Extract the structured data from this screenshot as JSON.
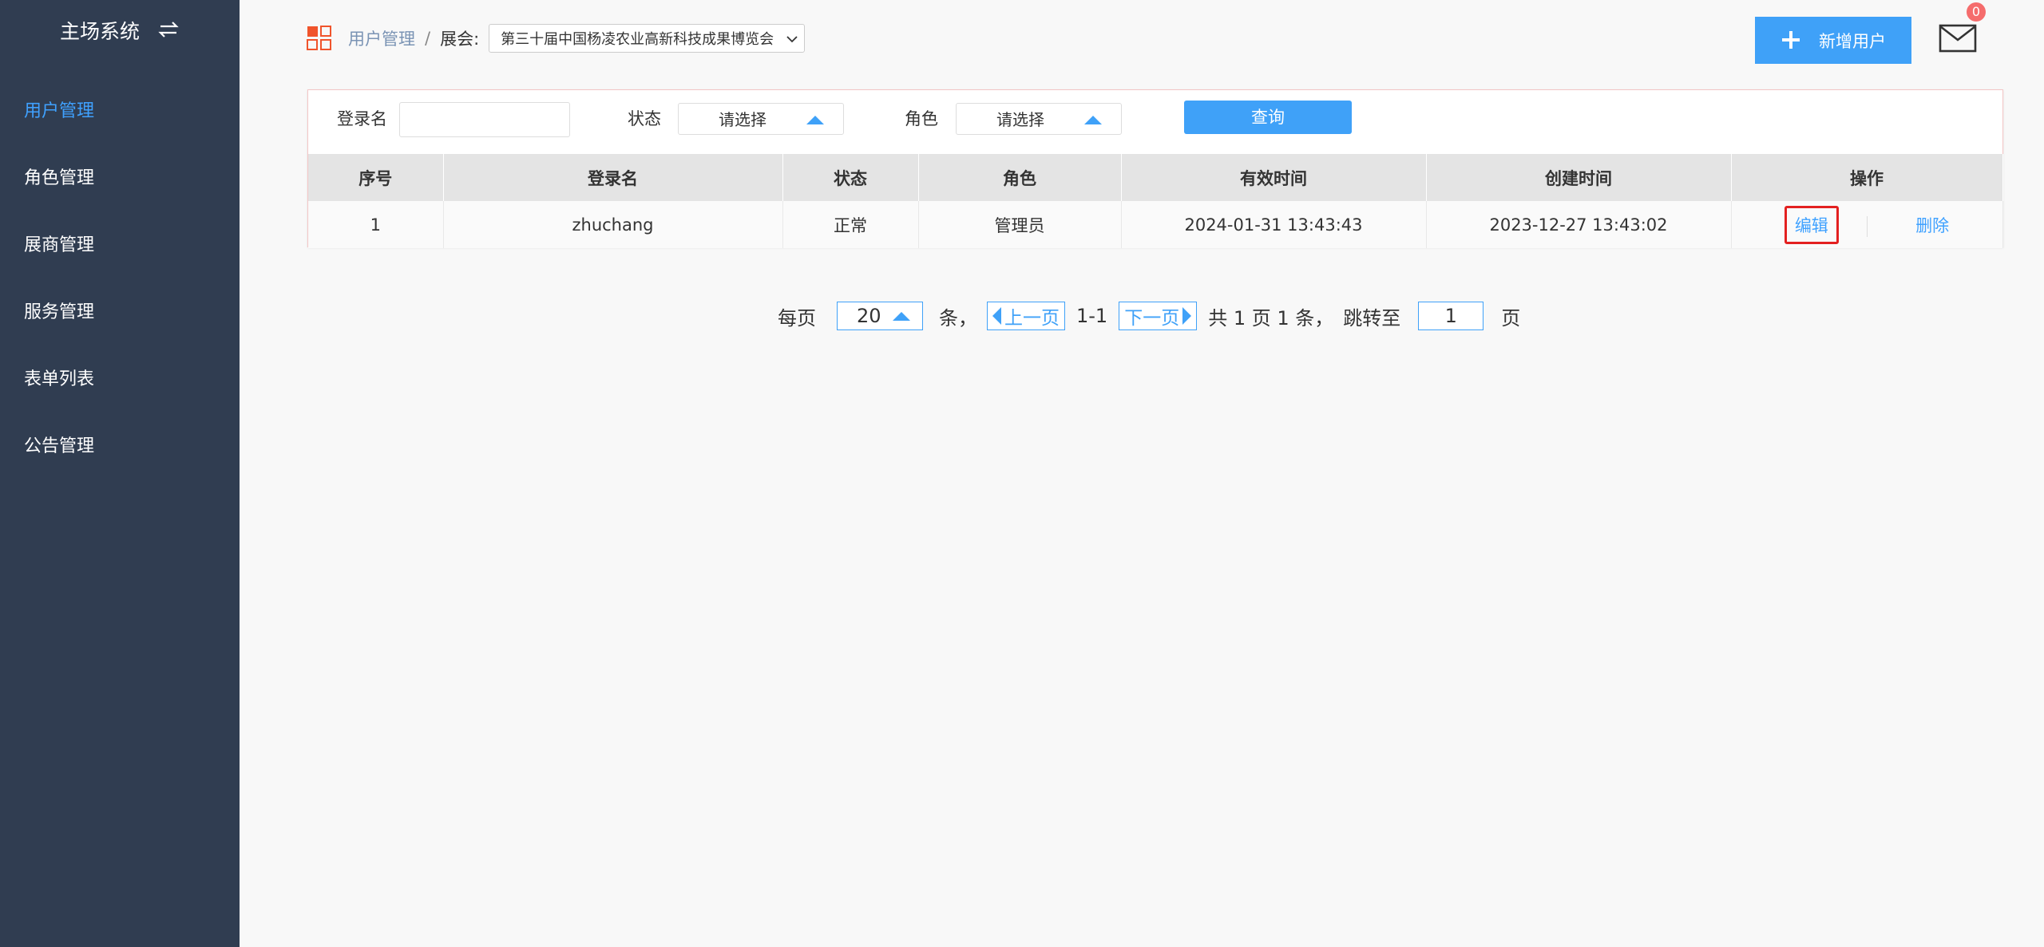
{
  "sidebar": {
    "brand": "主场系统",
    "items": [
      {
        "label": "用户管理"
      },
      {
        "label": "角色管理"
      },
      {
        "label": "展商管理"
      },
      {
        "label": "服务管理"
      },
      {
        "label": "表单列表"
      },
      {
        "label": "公告管理"
      }
    ],
    "active_index": 0
  },
  "header": {
    "breadcrumb": "用户管理",
    "separator": "/",
    "expo_label": "展会:",
    "expo_selected": "第三十届中国杨凌农业高新科技成果博览会",
    "add_user_label": "新增用户",
    "mail_badge": "0"
  },
  "filters": {
    "login_label": "登录名",
    "login_value": "",
    "status_label": "状态",
    "status_value": "请选择",
    "role_label": "角色",
    "role_value": "请选择",
    "query_label": "查询"
  },
  "table": {
    "columns": [
      "序号",
      "登录名",
      "状态",
      "角色",
      "有效时间",
      "创建时间",
      "操作"
    ],
    "rows": [
      {
        "index": "1",
        "login": "zhuchang",
        "status": "正常",
        "role": "管理员",
        "valid_time": "2024-01-31 13:43:43",
        "created_time": "2023-12-27 13:43:02",
        "edit": "编辑",
        "delete": "删除"
      }
    ]
  },
  "pager": {
    "per_page_label": "每页",
    "per_page": "20",
    "unit": "条，",
    "prev": "上一页",
    "range": "1-1",
    "next": "下一页",
    "summary": "共 1 页 1 条，",
    "jump_label": "跳转至",
    "jump_value": "1",
    "page_unit": "页"
  },
  "colors": {
    "sidebar_bg": "#303d51",
    "accent": "#3fa1f8",
    "highlight_border": "#e32020"
  }
}
